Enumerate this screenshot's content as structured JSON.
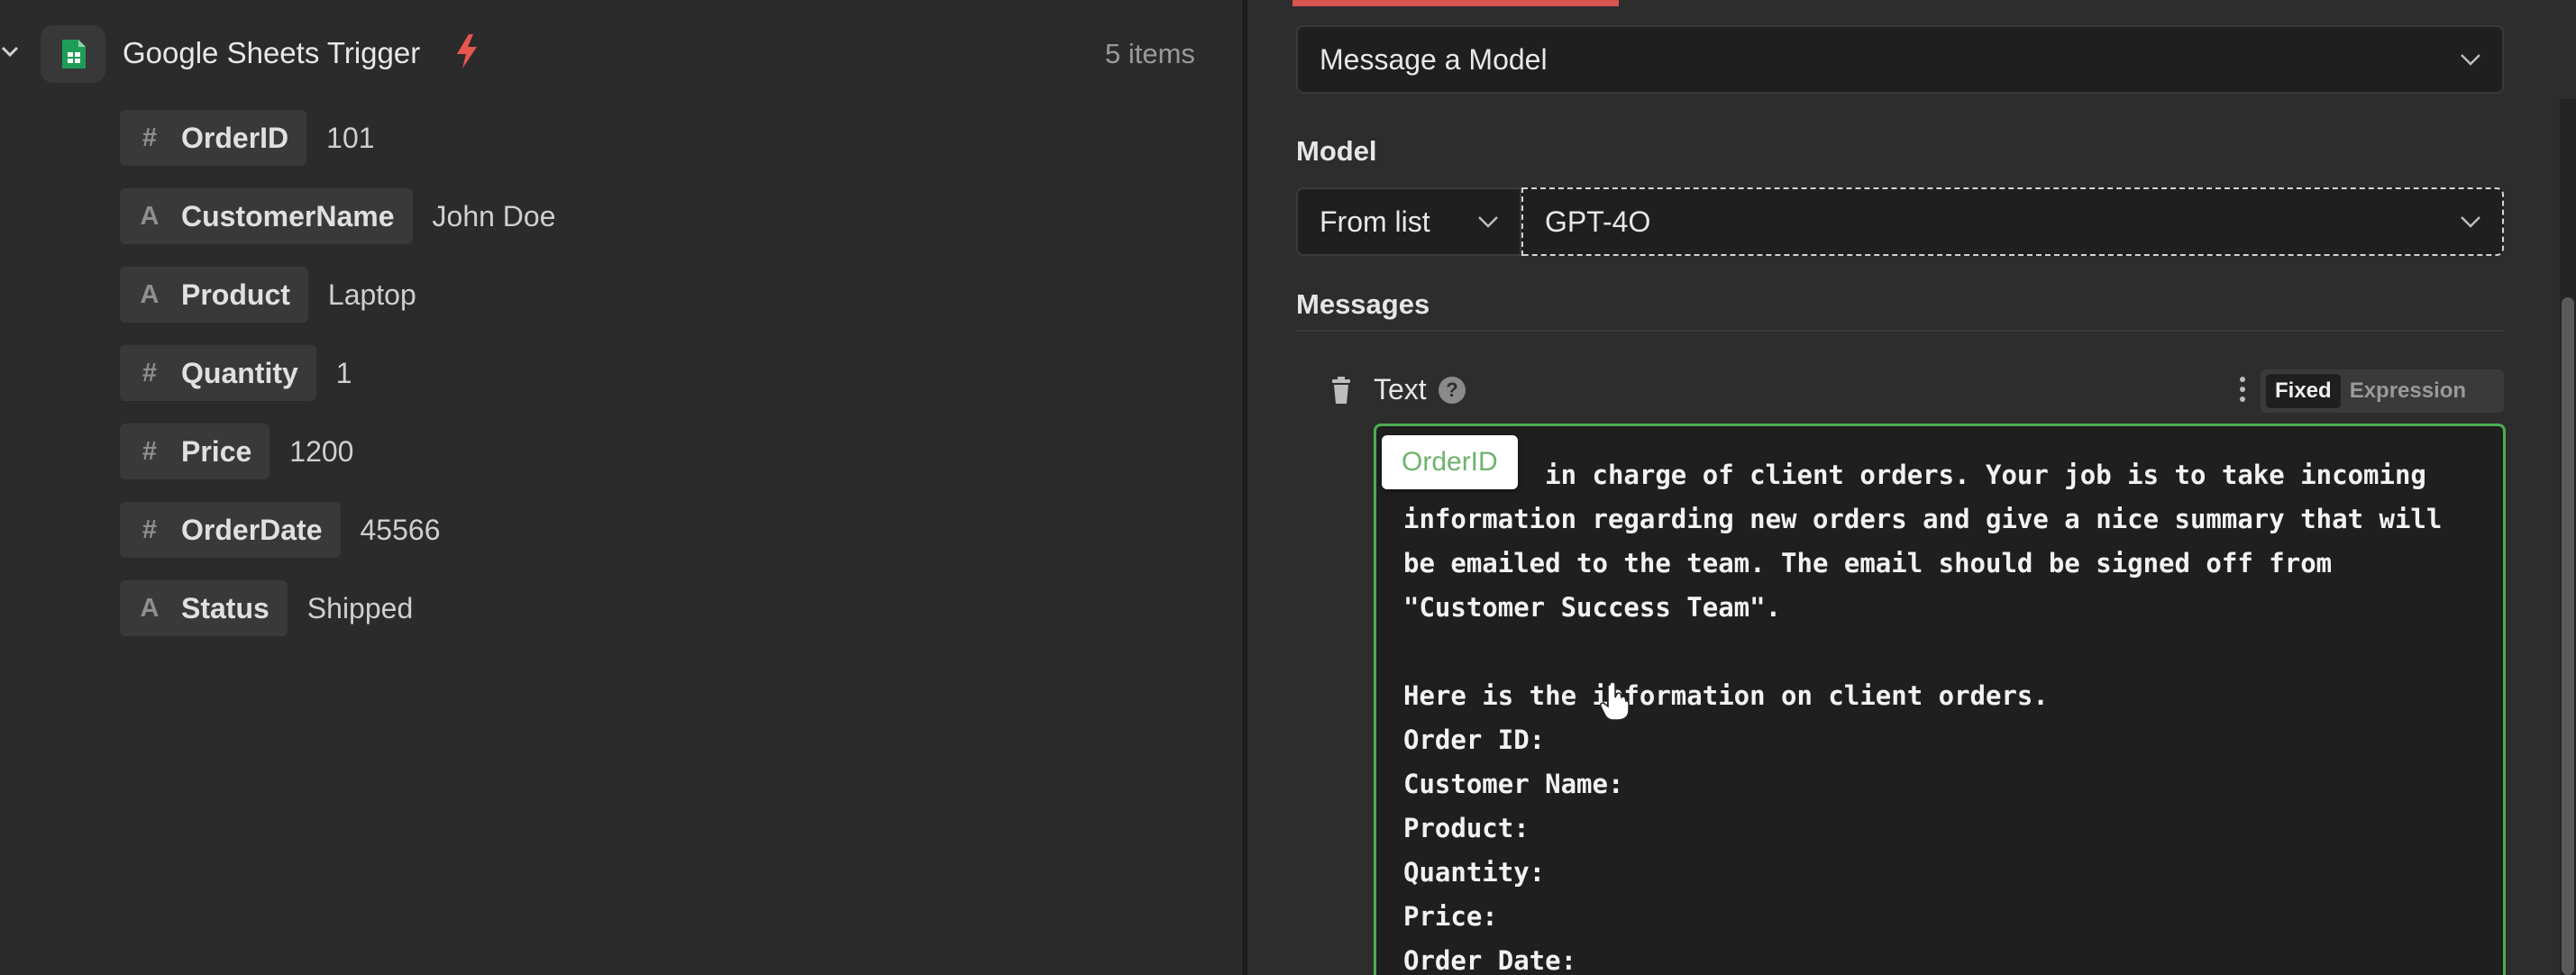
{
  "trigger": {
    "title": "Google Sheets Trigger",
    "items_count": "5 items",
    "icons": {
      "collapse": "chevron-down-icon",
      "app": "google-sheets-icon",
      "trigger": "lightning-bolt-icon"
    },
    "colors": {
      "sheets_green": "#1e9d58",
      "bolt_red": "#e8564e"
    }
  },
  "fields": [
    {
      "type_icon": "#",
      "name": "OrderID",
      "value": "101"
    },
    {
      "type_icon": "A",
      "name": "CustomerName",
      "value": "John Doe"
    },
    {
      "type_icon": "A",
      "name": "Product",
      "value": "Laptop"
    },
    {
      "type_icon": "#",
      "name": "Quantity",
      "value": "1"
    },
    {
      "type_icon": "#",
      "name": "Price",
      "value": "1200"
    },
    {
      "type_icon": "#",
      "name": "OrderDate",
      "value": "45566"
    },
    {
      "type_icon": "A",
      "name": "Status",
      "value": "Shipped"
    }
  ],
  "config": {
    "operation": "Message a Model",
    "model_label": "Model",
    "model_mode": "From list",
    "model_value": "GPT-4O",
    "messages_label": "Messages",
    "text_label": "Text",
    "help_glyph": "?",
    "toggle": {
      "fixed": "Fixed",
      "expression": "Expression"
    },
    "drag_tooltip": "OrderID",
    "message_lines": [
      "         in charge of client orders. Your job is to take incoming",
      "information regarding new orders and give a nice summary that will",
      "be emailed to the team. The email should be signed off from",
      "\"Customer Success Team\".",
      "",
      "Here is the information on client orders.",
      "Order ID:",
      "Customer Name:",
      "Product:",
      "Quantity:",
      "Price:",
      "Order Date:"
    ],
    "colors": {
      "editor_border": "#4caf50",
      "accent_bar": "#d9534f"
    }
  }
}
